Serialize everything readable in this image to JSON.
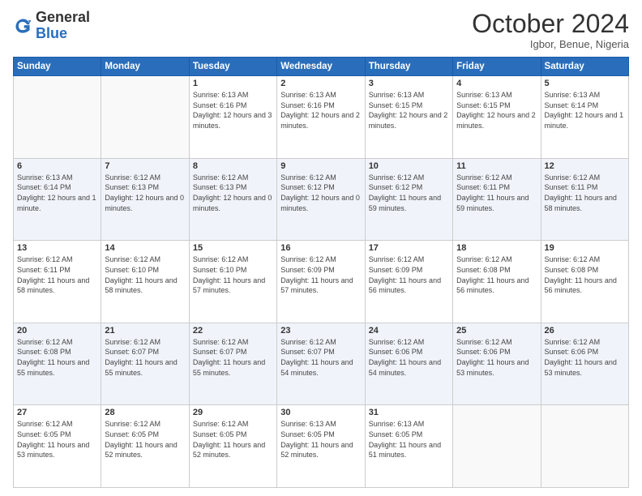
{
  "logo": {
    "general": "General",
    "blue": "Blue"
  },
  "header": {
    "month": "October 2024",
    "location": "Igbor, Benue, Nigeria"
  },
  "weekdays": [
    "Sunday",
    "Monday",
    "Tuesday",
    "Wednesday",
    "Thursday",
    "Friday",
    "Saturday"
  ],
  "weeks": [
    [
      {
        "day": "",
        "sunrise": "",
        "sunset": "",
        "daylight": ""
      },
      {
        "day": "",
        "sunrise": "",
        "sunset": "",
        "daylight": ""
      },
      {
        "day": "1",
        "sunrise": "Sunrise: 6:13 AM",
        "sunset": "Sunset: 6:16 PM",
        "daylight": "Daylight: 12 hours and 3 minutes."
      },
      {
        "day": "2",
        "sunrise": "Sunrise: 6:13 AM",
        "sunset": "Sunset: 6:16 PM",
        "daylight": "Daylight: 12 hours and 2 minutes."
      },
      {
        "day": "3",
        "sunrise": "Sunrise: 6:13 AM",
        "sunset": "Sunset: 6:15 PM",
        "daylight": "Daylight: 12 hours and 2 minutes."
      },
      {
        "day": "4",
        "sunrise": "Sunrise: 6:13 AM",
        "sunset": "Sunset: 6:15 PM",
        "daylight": "Daylight: 12 hours and 2 minutes."
      },
      {
        "day": "5",
        "sunrise": "Sunrise: 6:13 AM",
        "sunset": "Sunset: 6:14 PM",
        "daylight": "Daylight: 12 hours and 1 minute."
      }
    ],
    [
      {
        "day": "6",
        "sunrise": "Sunrise: 6:13 AM",
        "sunset": "Sunset: 6:14 PM",
        "daylight": "Daylight: 12 hours and 1 minute."
      },
      {
        "day": "7",
        "sunrise": "Sunrise: 6:12 AM",
        "sunset": "Sunset: 6:13 PM",
        "daylight": "Daylight: 12 hours and 0 minutes."
      },
      {
        "day": "8",
        "sunrise": "Sunrise: 6:12 AM",
        "sunset": "Sunset: 6:13 PM",
        "daylight": "Daylight: 12 hours and 0 minutes."
      },
      {
        "day": "9",
        "sunrise": "Sunrise: 6:12 AM",
        "sunset": "Sunset: 6:12 PM",
        "daylight": "Daylight: 12 hours and 0 minutes."
      },
      {
        "day": "10",
        "sunrise": "Sunrise: 6:12 AM",
        "sunset": "Sunset: 6:12 PM",
        "daylight": "Daylight: 11 hours and 59 minutes."
      },
      {
        "day": "11",
        "sunrise": "Sunrise: 6:12 AM",
        "sunset": "Sunset: 6:11 PM",
        "daylight": "Daylight: 11 hours and 59 minutes."
      },
      {
        "day": "12",
        "sunrise": "Sunrise: 6:12 AM",
        "sunset": "Sunset: 6:11 PM",
        "daylight": "Daylight: 11 hours and 58 minutes."
      }
    ],
    [
      {
        "day": "13",
        "sunrise": "Sunrise: 6:12 AM",
        "sunset": "Sunset: 6:11 PM",
        "daylight": "Daylight: 11 hours and 58 minutes."
      },
      {
        "day": "14",
        "sunrise": "Sunrise: 6:12 AM",
        "sunset": "Sunset: 6:10 PM",
        "daylight": "Daylight: 11 hours and 58 minutes."
      },
      {
        "day": "15",
        "sunrise": "Sunrise: 6:12 AM",
        "sunset": "Sunset: 6:10 PM",
        "daylight": "Daylight: 11 hours and 57 minutes."
      },
      {
        "day": "16",
        "sunrise": "Sunrise: 6:12 AM",
        "sunset": "Sunset: 6:09 PM",
        "daylight": "Daylight: 11 hours and 57 minutes."
      },
      {
        "day": "17",
        "sunrise": "Sunrise: 6:12 AM",
        "sunset": "Sunset: 6:09 PM",
        "daylight": "Daylight: 11 hours and 56 minutes."
      },
      {
        "day": "18",
        "sunrise": "Sunrise: 6:12 AM",
        "sunset": "Sunset: 6:08 PM",
        "daylight": "Daylight: 11 hours and 56 minutes."
      },
      {
        "day": "19",
        "sunrise": "Sunrise: 6:12 AM",
        "sunset": "Sunset: 6:08 PM",
        "daylight": "Daylight: 11 hours and 56 minutes."
      }
    ],
    [
      {
        "day": "20",
        "sunrise": "Sunrise: 6:12 AM",
        "sunset": "Sunset: 6:08 PM",
        "daylight": "Daylight: 11 hours and 55 minutes."
      },
      {
        "day": "21",
        "sunrise": "Sunrise: 6:12 AM",
        "sunset": "Sunset: 6:07 PM",
        "daylight": "Daylight: 11 hours and 55 minutes."
      },
      {
        "day": "22",
        "sunrise": "Sunrise: 6:12 AM",
        "sunset": "Sunset: 6:07 PM",
        "daylight": "Daylight: 11 hours and 55 minutes."
      },
      {
        "day": "23",
        "sunrise": "Sunrise: 6:12 AM",
        "sunset": "Sunset: 6:07 PM",
        "daylight": "Daylight: 11 hours and 54 minutes."
      },
      {
        "day": "24",
        "sunrise": "Sunrise: 6:12 AM",
        "sunset": "Sunset: 6:06 PM",
        "daylight": "Daylight: 11 hours and 54 minutes."
      },
      {
        "day": "25",
        "sunrise": "Sunrise: 6:12 AM",
        "sunset": "Sunset: 6:06 PM",
        "daylight": "Daylight: 11 hours and 53 minutes."
      },
      {
        "day": "26",
        "sunrise": "Sunrise: 6:12 AM",
        "sunset": "Sunset: 6:06 PM",
        "daylight": "Daylight: 11 hours and 53 minutes."
      }
    ],
    [
      {
        "day": "27",
        "sunrise": "Sunrise: 6:12 AM",
        "sunset": "Sunset: 6:05 PM",
        "daylight": "Daylight: 11 hours and 53 minutes."
      },
      {
        "day": "28",
        "sunrise": "Sunrise: 6:12 AM",
        "sunset": "Sunset: 6:05 PM",
        "daylight": "Daylight: 11 hours and 52 minutes."
      },
      {
        "day": "29",
        "sunrise": "Sunrise: 6:12 AM",
        "sunset": "Sunset: 6:05 PM",
        "daylight": "Daylight: 11 hours and 52 minutes."
      },
      {
        "day": "30",
        "sunrise": "Sunrise: 6:13 AM",
        "sunset": "Sunset: 6:05 PM",
        "daylight": "Daylight: 11 hours and 52 minutes."
      },
      {
        "day": "31",
        "sunrise": "Sunrise: 6:13 AM",
        "sunset": "Sunset: 6:05 PM",
        "daylight": "Daylight: 11 hours and 51 minutes."
      },
      {
        "day": "",
        "sunrise": "",
        "sunset": "",
        "daylight": ""
      },
      {
        "day": "",
        "sunrise": "",
        "sunset": "",
        "daylight": ""
      }
    ]
  ]
}
